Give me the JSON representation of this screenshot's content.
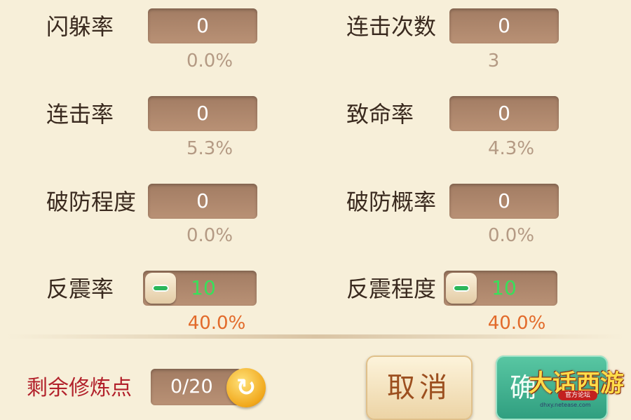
{
  "stats": [
    {
      "label": "闪躲率",
      "value": "0",
      "percent": "0.0%"
    },
    {
      "label": "连击次数",
      "value": "0",
      "percent": "3"
    },
    {
      "label": "连击率",
      "value": "0",
      "percent": "5.3%"
    },
    {
      "label": "致命率",
      "value": "0",
      "percent": "4.3%"
    },
    {
      "label": "破防程度",
      "value": "0",
      "percent": "0.0%"
    },
    {
      "label": "破防概率",
      "value": "0",
      "percent": "0.0%"
    },
    {
      "label": "反震率",
      "value": "10",
      "percent": "40.0%"
    },
    {
      "label": "反震程度",
      "value": "10",
      "percent": "40.0%"
    }
  ],
  "footer": {
    "remaining_label": "剩余修炼点",
    "remaining_value": "0/20",
    "cancel_label": "取消",
    "confirm_label": "确"
  },
  "logo": {
    "title": "大话西游",
    "badge": "官方论坛",
    "url": "dhxy.netease.com"
  },
  "colors": {
    "background": "#f7efd9",
    "value_box": "#a27c63",
    "active_value": "#38e05a",
    "active_percent": "#e26a2a",
    "remaining_label": "#b2212b"
  }
}
